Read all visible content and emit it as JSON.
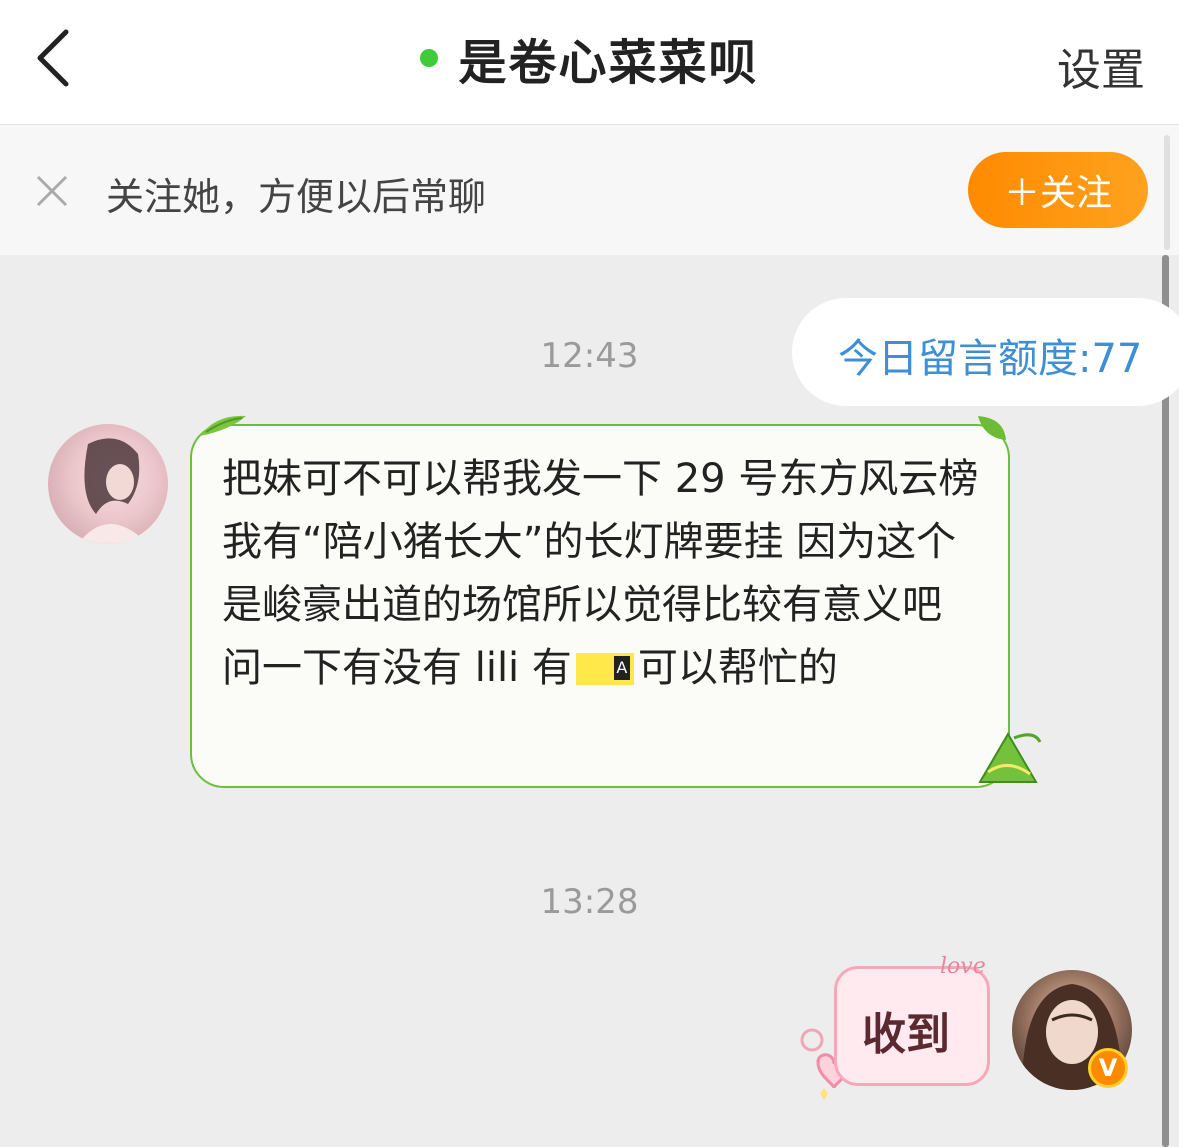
{
  "header": {
    "title": "是卷心菜菜呗",
    "settings_label": "设置",
    "online_color": "#3fcb3a"
  },
  "follow_bar": {
    "prompt": "关注她，方便以后常聊",
    "follow_button": "＋关注"
  },
  "quota": {
    "label": "今日留言额度:77"
  },
  "messages": [
    {
      "timestamp": "12:43",
      "side": "left",
      "text_before_icon": "把妹可不可以帮我发一下 29 号东方风云榜我有“陪小猪长大”的长灯牌要挂 因为这个是峻豪出道的场馆所以觉得比较有意义吧 问一下有没有 lili 有",
      "icon": "concert-ticket-icon",
      "text_after_icon": "可以帮忙的"
    },
    {
      "timestamp": "13:28",
      "side": "right",
      "text": "收到",
      "sticker_word": "love"
    }
  ],
  "icons": [
    "back-arrow-icon",
    "online-dot-icon",
    "close-icon",
    "leaf-icon",
    "zongzi-icon",
    "verified-icon",
    "heart-icon"
  ]
}
